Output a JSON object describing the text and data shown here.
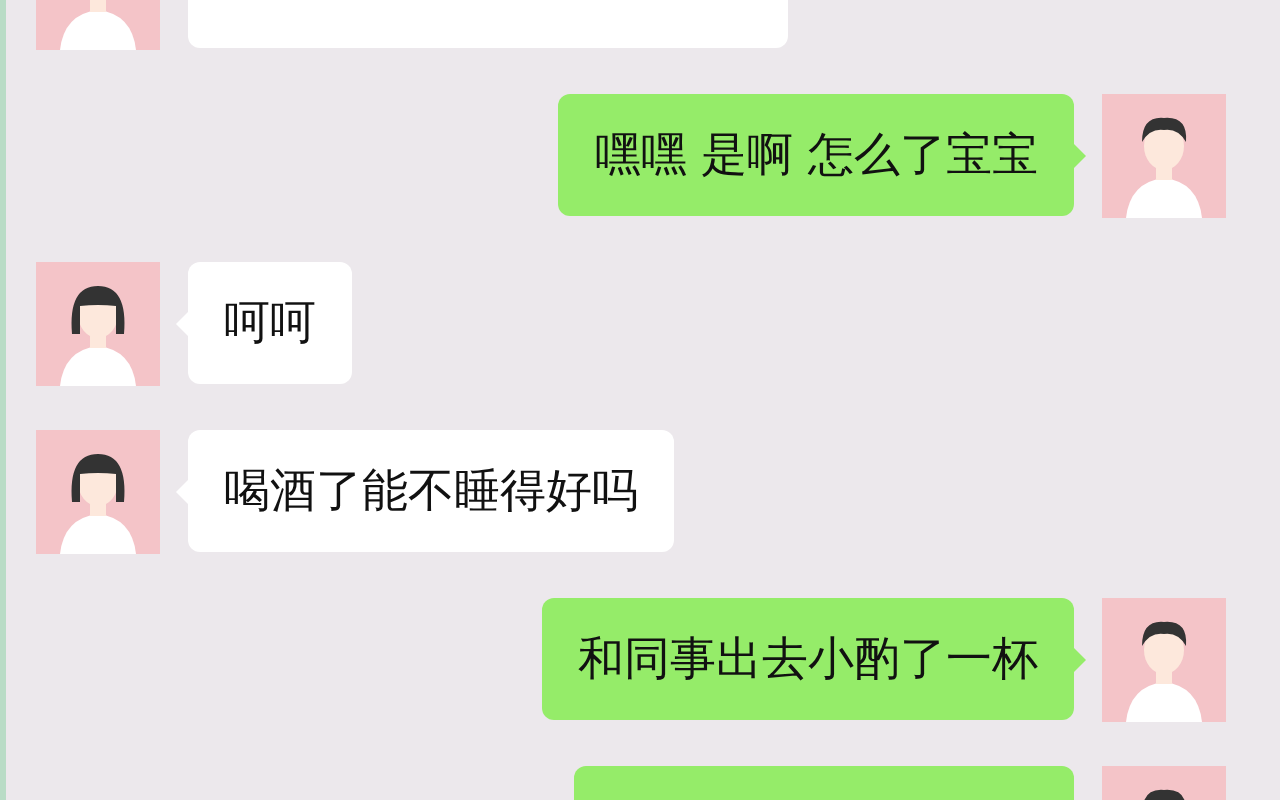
{
  "messages": [
    {
      "kind": "received"
    },
    {
      "kind": "sent",
      "text": "嘿嘿 是啊 怎么了宝宝"
    },
    {
      "kind": "received",
      "text": "呵呵"
    },
    {
      "kind": "received",
      "text": "喝酒了能不睡得好吗"
    },
    {
      "kind": "sent",
      "text": "和同事出去小酌了一杯"
    },
    {
      "kind": "sent"
    }
  ]
}
